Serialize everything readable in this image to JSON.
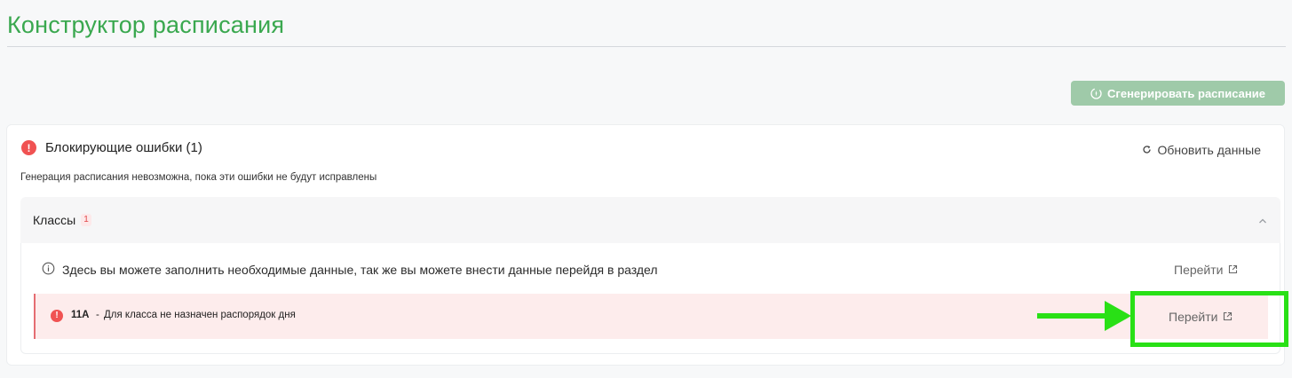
{
  "page": {
    "title": "Конструктор расписания"
  },
  "toolbar": {
    "generate_label": "Сгенерировать расписание",
    "generate_icon": "magic-wand-icon"
  },
  "errors_card": {
    "title": "Блокирующие ошибки (1)",
    "refresh_label": "Обновить данные",
    "subtitle": "Генерация расписания невозможна, пока эти ошибки не будут исправлены",
    "section": {
      "title": "Классы",
      "count": "1",
      "info_text": "Здесь вы можете заполнить необходимые данные, так же вы можете внести данные перейдя в раздел",
      "goto_label": "Перейти",
      "items": [
        {
          "class_name": "11А",
          "separator": "-",
          "message": "Для класса не назначен распорядок дня",
          "goto_label": "Перейти"
        }
      ]
    }
  },
  "colors": {
    "title_green": "#3aa84f",
    "button_disabled_green": "#9fcaa9",
    "error_red": "#f05252",
    "error_row_bg": "#fdecec",
    "annotation_green": "#29e016"
  }
}
